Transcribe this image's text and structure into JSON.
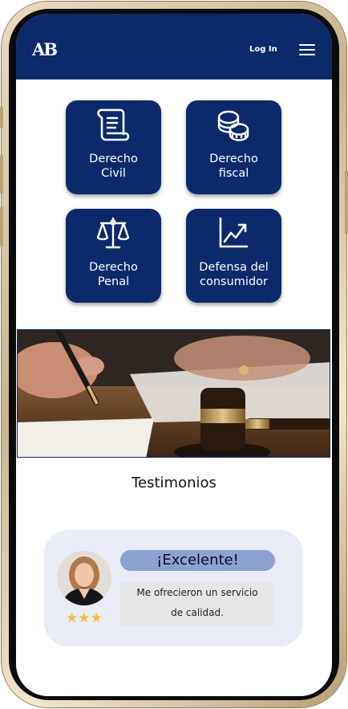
{
  "header": {
    "logo": "AB",
    "login_label": "Log In",
    "menu_icon": "hamburger-icon"
  },
  "services": [
    {
      "line1": "Derecho",
      "line2": "Civil",
      "icon": "scroll-icon"
    },
    {
      "line1": "Derecho",
      "line2": "fiscal",
      "icon": "coins-icon"
    },
    {
      "line1": "Derecho",
      "line2": "Penal",
      "icon": "scales-icon"
    },
    {
      "line1": "Defensa del",
      "line2": "consumidor",
      "icon": "chart-up-icon"
    }
  ],
  "testimonials": {
    "title": "Testimonios",
    "item": {
      "headline": "¡Excelente!",
      "quote_line1": "Me ofrecieron un servicio",
      "quote_line2": "de calidad.",
      "rating": 3,
      "stars": "★★★"
    }
  },
  "colors": {
    "brand": "#0c2a6b",
    "badge": "#8da2d3",
    "testimonial_bg": "#e9ecf7",
    "star": "#f2c23a"
  }
}
